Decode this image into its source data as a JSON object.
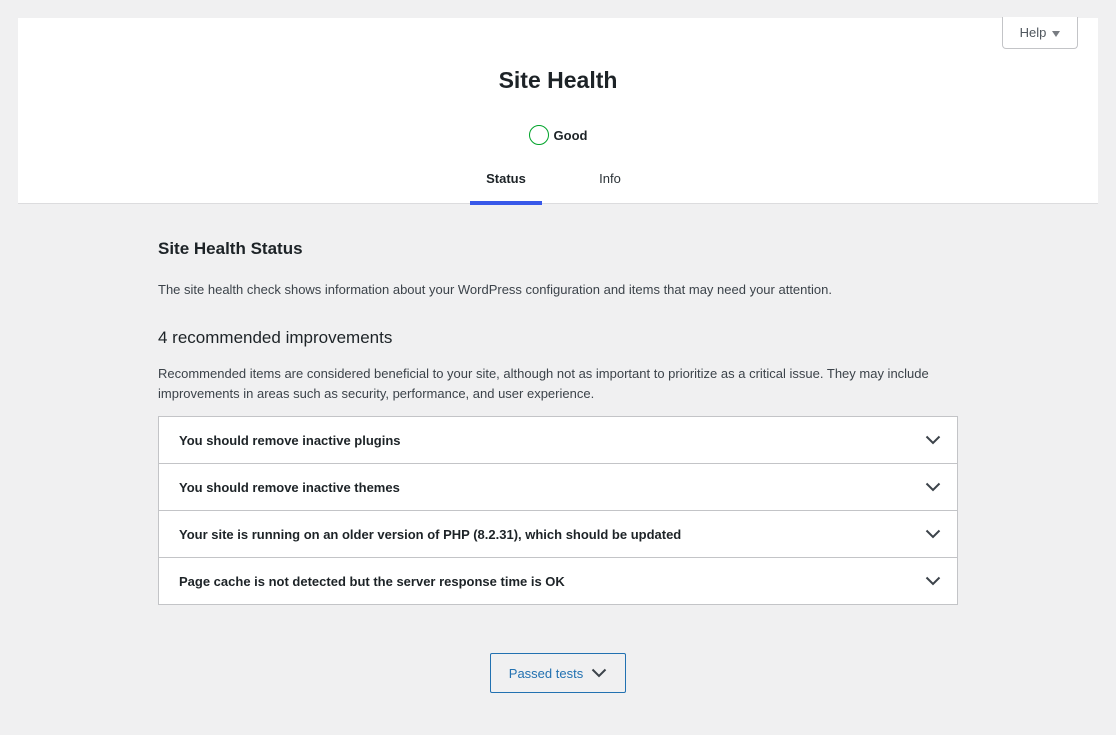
{
  "header": {
    "title": "Site Health",
    "help_label": "Help",
    "score": {
      "label": "Good",
      "color": "#00a32a"
    },
    "tabs": [
      {
        "label": "Status",
        "active": true
      },
      {
        "label": "Info",
        "active": false
      }
    ]
  },
  "main": {
    "section_title": "Site Health Status",
    "section_description": "The site health check shows information about your WordPress configuration and items that may need your attention.",
    "improvements_title": "4 recommended improvements",
    "improvements_description": "Recommended items are considered beneficial to your site, although not as important to prioritize as a critical issue. They may include improvements in areas such as security, performance, and user experience.",
    "items": [
      {
        "label": "You should remove inactive plugins"
      },
      {
        "label": "You should remove inactive themes"
      },
      {
        "label": "Your site is running on an older version of PHP (8.2.31), which should be updated"
      },
      {
        "label": "Page cache is not detected but the server response time is OK"
      }
    ],
    "passed_tests_label": "Passed tests"
  },
  "colors": {
    "accent": "#3858e9",
    "link": "#2271b1",
    "good": "#00a32a"
  },
  "icons": {
    "help_arrow": "caret-down-icon",
    "item_toggle": "chevron-down-icon",
    "passed_toggle": "chevron-down-icon"
  }
}
